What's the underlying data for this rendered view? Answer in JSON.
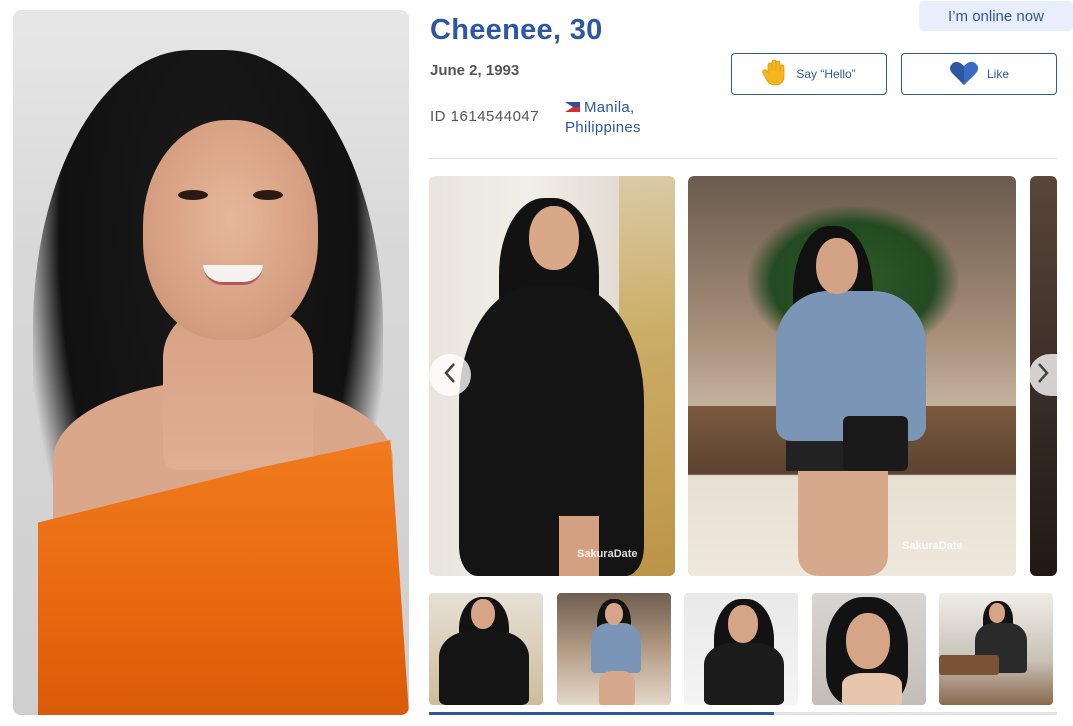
{
  "profile": {
    "name_age": "Cheenee, 30",
    "birth_date": "June 2, 1993",
    "id_label": "ID 1614544047",
    "location_line1": "Manila,",
    "location_line2": "Philippines",
    "country_flag": "philippines-flag"
  },
  "status": {
    "online_label": "I’m online now"
  },
  "actions": {
    "hello_label": "Say “Hello”",
    "like_label": "Like"
  },
  "gallery": {
    "watermark": "SakuraDate",
    "progress_fraction": 0.55,
    "thumbnails_count": 5
  },
  "colors": {
    "accent": "#2e57a1",
    "badge_bg": "#e8eefb",
    "hand_icon": "#f3b61f"
  }
}
